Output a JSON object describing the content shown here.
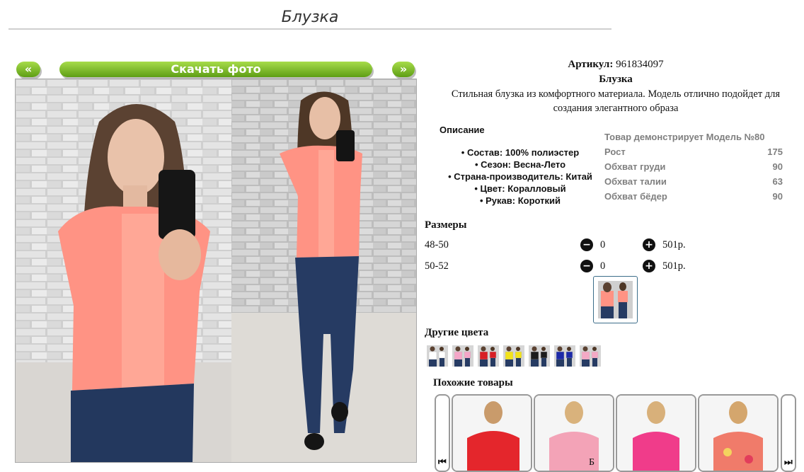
{
  "page": {
    "title": "Блузка"
  },
  "gallery": {
    "prev_label": "«",
    "next_label": "»",
    "download_label": "Скачать фото"
  },
  "product": {
    "article_label": "Артикул:",
    "article_value": "961834097",
    "name": "Блузка",
    "description": "Стильная блузка из комфортного материала. Модель отлично подойдет для создания элегантного образа"
  },
  "description_section": {
    "heading": "Описание",
    "items": [
      "Состав: 100% полиэстер",
      "Сезон: Весна-Лето",
      "Страна-производитель: Китай",
      "Цвет: Коралловый",
      "Рукав: Короткий"
    ]
  },
  "model_info": {
    "heading": "Товар демонстрирует Модель №80",
    "rows": [
      {
        "label": "Рост",
        "value": "175"
      },
      {
        "label": "Обхват груди",
        "value": "90"
      },
      {
        "label": "Обхват талии",
        "value": "63"
      },
      {
        "label": "Обхват бёдер",
        "value": "90"
      }
    ]
  },
  "sizes": {
    "heading": "Размеры",
    "rows": [
      {
        "size": "48-50",
        "qty": "0",
        "price": "501р."
      },
      {
        "size": "50-52",
        "qty": "0",
        "price": "501р."
      }
    ]
  },
  "other_colors": {
    "heading": "Другие цвета",
    "swatches": [
      "#ffffff",
      "#f4a6c8",
      "#d81f26",
      "#f2e21b",
      "#1c1c1c",
      "#1d2aa8",
      "#f3a9c5"
    ]
  },
  "similar": {
    "heading": "Похожие товары",
    "prev_icon": "skip-back-icon",
    "next_icon": "skip-forward-icon",
    "caption": "Б"
  },
  "colors": {
    "accent_green": "#6aa81c",
    "blouse": "#ff9384"
  }
}
